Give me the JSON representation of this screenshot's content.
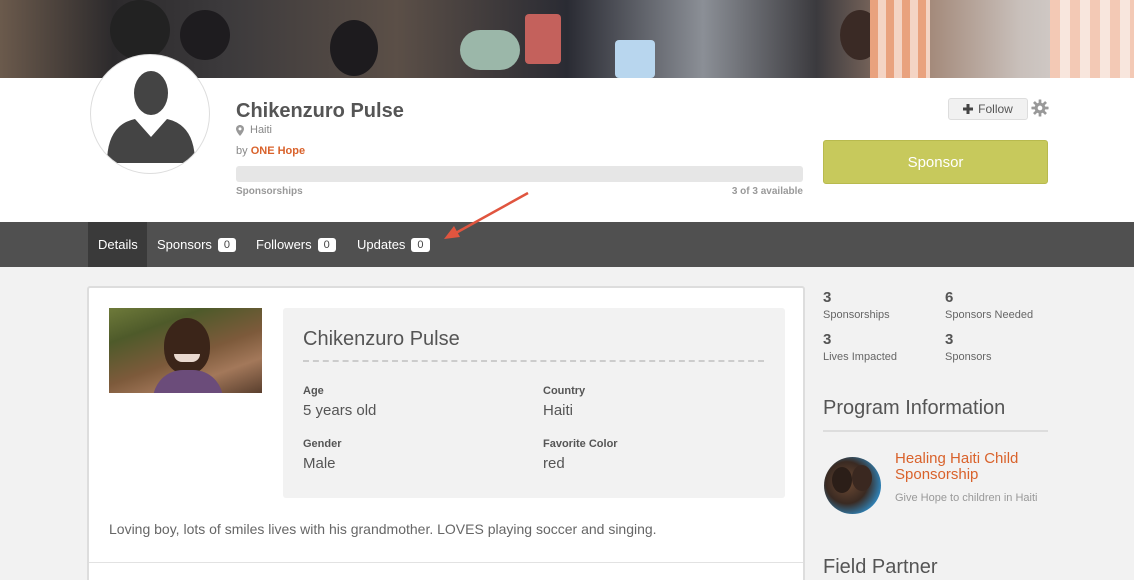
{
  "profile": {
    "name": "Chikenzuro Pulse",
    "location": "Haiti",
    "by_prefix": "by ",
    "organization": "ONE Hope",
    "progress_label": "Sponsorships",
    "progress_count": "3 of 3 available",
    "progress_fraction": 0.0,
    "follow_label": "Follow",
    "sponsor_label": "Sponsor"
  },
  "tabs": [
    {
      "label": "Details",
      "count": null
    },
    {
      "label": "Sponsors",
      "count": "0"
    },
    {
      "label": "Followers",
      "count": "0"
    },
    {
      "label": "Updates",
      "count": "0"
    }
  ],
  "details": {
    "title": "Chikenzuro Pulse",
    "age_label": "Age",
    "age_value": "5 years old",
    "country_label": "Country",
    "country_value": "Haiti",
    "gender_label": "Gender",
    "gender_value": "Male",
    "color_label": "Favorite Color",
    "color_value": "red",
    "bio": "Loving boy, lots of smiles lives with his grandmother. LOVES playing soccer and singing."
  },
  "stats": [
    {
      "value": "3",
      "label": "Sponsorships"
    },
    {
      "value": "6",
      "label": "Sponsors Needed"
    },
    {
      "value": "3",
      "label": "Lives Impacted"
    },
    {
      "value": "3",
      "label": "Sponsors"
    }
  ],
  "program": {
    "section_title": "Program Information",
    "name": "Healing Haiti Child Sponsorship",
    "description": "Give Hope to children in Haiti"
  },
  "partner": {
    "section_title": "Field Partner"
  },
  "colors": {
    "accent": "#d9622b",
    "sponsor_button": "#c7c95c",
    "tabbar": "#505050",
    "annotation_arrow": "#e0553f"
  },
  "icons": [
    "map-pin-icon",
    "plus-icon",
    "gear-icon",
    "annotation-arrow"
  ]
}
